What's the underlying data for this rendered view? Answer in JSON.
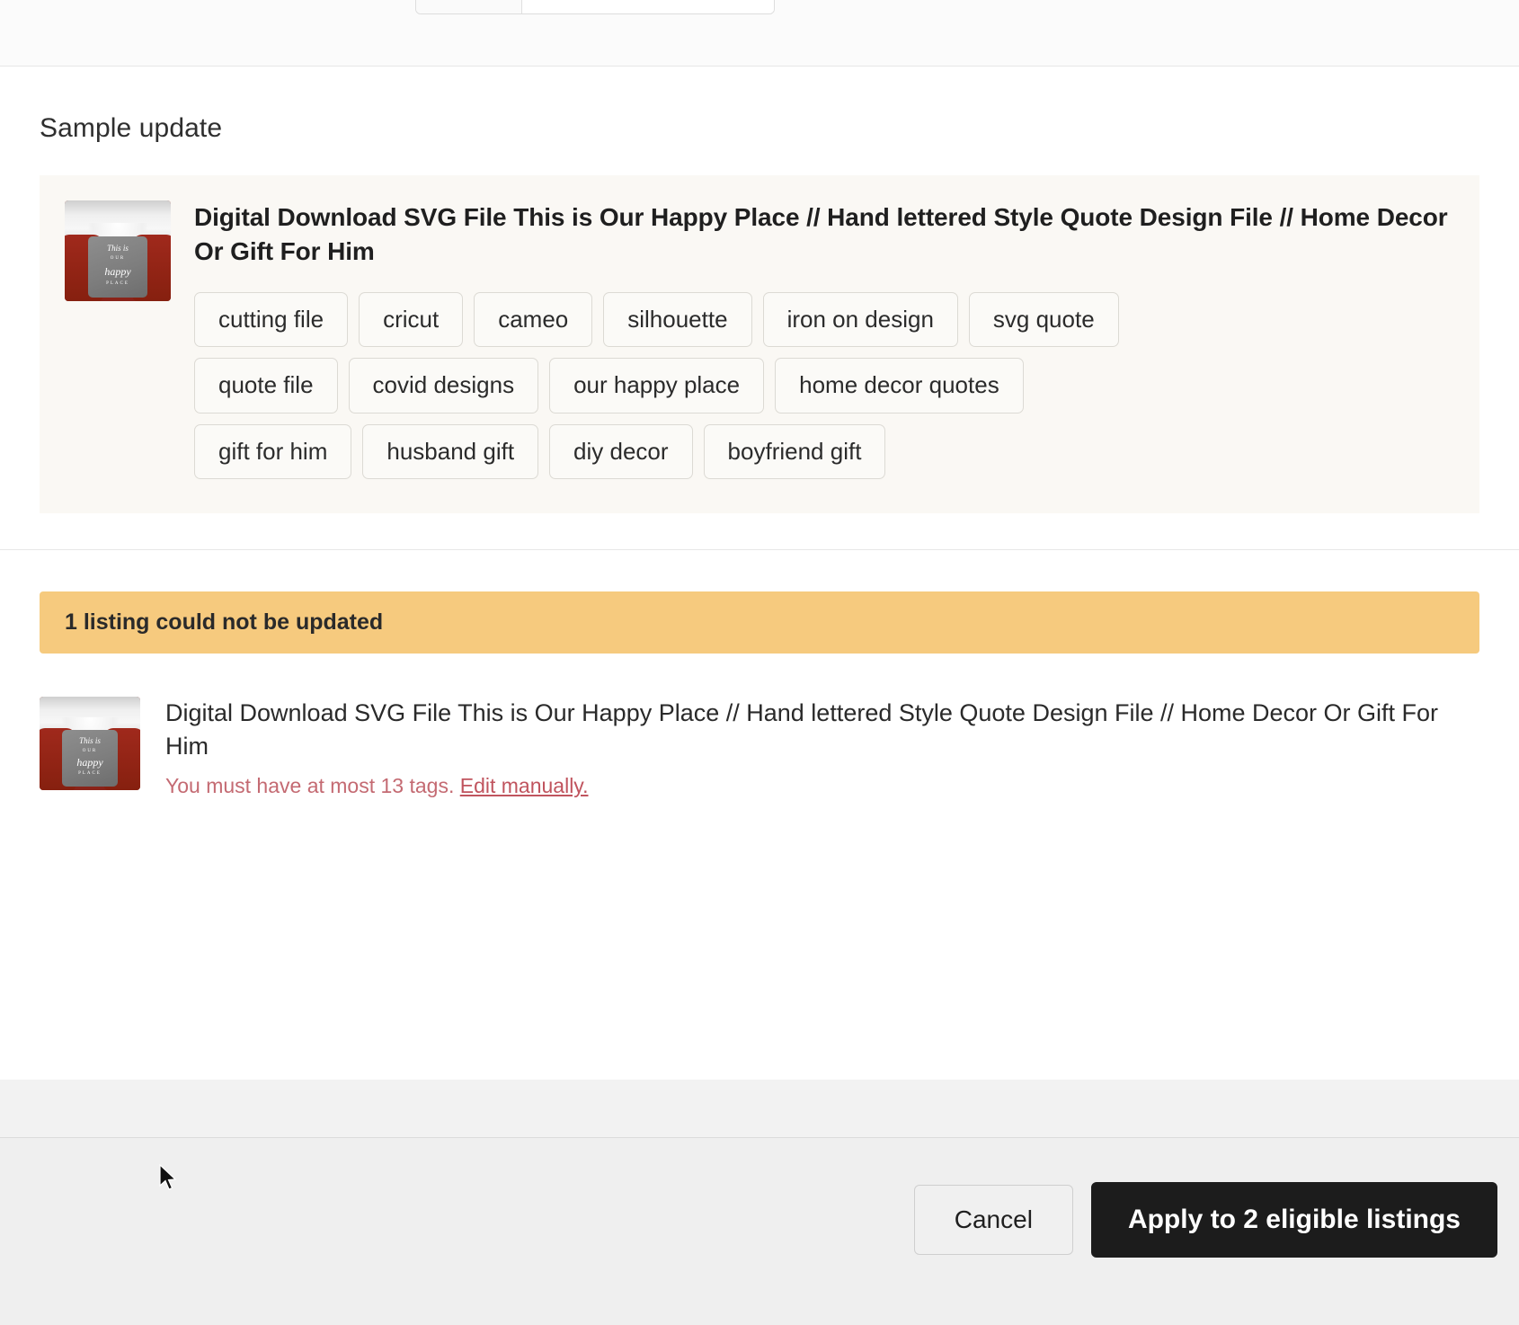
{
  "section": {
    "sample_update_label": "Sample update"
  },
  "sample_listing": {
    "title": "Digital Download SVG File This is Our Happy Place // Hand lettered Style Quote Design File // Home Decor Or Gift For Him",
    "thumbnail_alt": "gray pillow with hand lettered quote on red bedding",
    "pillow_text": {
      "line1": "This is",
      "line2": "OUR",
      "line3": "happy",
      "line4": "PLACE"
    },
    "tags": [
      "cutting file",
      "cricut",
      "cameo",
      "silhouette",
      "iron on design",
      "svg quote",
      "quote file",
      "covid designs",
      "our happy place",
      "home decor quotes",
      "gift for him",
      "husband gift",
      "diy decor",
      "boyfriend gift"
    ]
  },
  "warning": {
    "banner_text": "1 listing could not be updated",
    "banner_color": "#f6ca7e"
  },
  "failed_listing": {
    "title": "Digital Download SVG File This is Our Happy Place // Hand lettered Style Quote Design File // Home Decor Or Gift For Him",
    "error_text": "You must have at most 13 tags.",
    "error_link": "Edit manually.",
    "error_color": "#c46a72"
  },
  "footer": {
    "cancel_label": "Cancel",
    "apply_label": "Apply to 2 eligible listings",
    "apply_bg": "#1c1c1c"
  }
}
